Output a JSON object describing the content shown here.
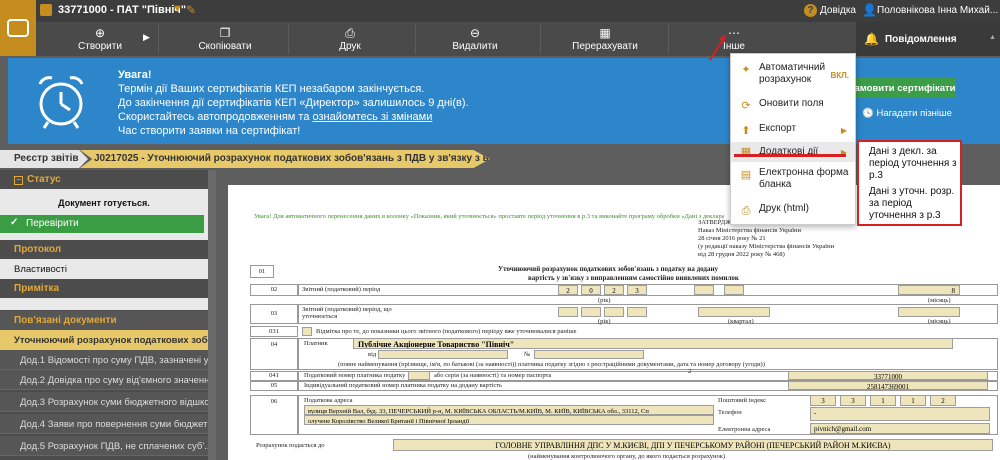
{
  "titlebar": {
    "title": "33771000 - ПАТ \"Північ\"",
    "help": "Довідка",
    "user": "Половнікова Інна Михай..."
  },
  "toolbar": {
    "create": "Створити",
    "copy": "Скопіювати",
    "print": "Друк",
    "delete": "Видалити",
    "recalc": "Перерахувати",
    "more": "Інше",
    "notifications": "Повідомлення"
  },
  "banner": {
    "title": "Увага!",
    "line1": "Термін дії Ваших сертифікатів КЕП незабаром закінчується.",
    "line2": "До закінчення дії сертифікатів КЕП «Директор» залишилось 9 дні(в).",
    "line3_pre": "Скористайтесь автопродовженням та ",
    "line3_link": "ознайомтесь зі змінами",
    "line4": "Час створити заявки на сертифікат!",
    "renew": "Замовити сертифікати",
    "remind": "Нагадати пізніше"
  },
  "breadcrumb": {
    "root": "Реєстр звітів",
    "doc": "J0217025 - Уточнюючий розрахунок податкових зобов'язань з ПДВ у зв'язку з виправ..."
  },
  "left": {
    "status_head": "Статус",
    "status": "Документ готується.",
    "check": "Перевірити",
    "protocol": "Протокол",
    "props": "Властивості",
    "note": "Примітка",
    "related": "Пов'язані документи",
    "items": [
      "Уточнюючий розрахунок податкових зобов'яза...",
      "Дод.1 Відомості про суму ПДВ, зазначені у ПН...",
      "Дод.2 Довідка про суму від'ємного значення з...",
      "Дод.3 Розрахунок суми бюджетного відшкоду...",
      "Дод.4 Заяви про повернення суми бюджетног...",
      "Дод.5 Розрахунок ПДВ, не сплачених суб'..."
    ]
  },
  "menu": {
    "auto": "Автоматичний розрахунок",
    "auto_badge": "ВКЛ.",
    "refresh": "Оновити поля",
    "export": "Експорт",
    "extra": "Додаткові дії",
    "eform": "Електронна форма бланка",
    "print_html": "Друк (html)"
  },
  "submenu": {
    "item1": "Дані з декл. за період уточнення з р.3",
    "item2": "Дані з уточн. розр. за період уточнення з р.3"
  },
  "doc": {
    "notice": "Увага! Для автоматичного перенесення даних в колонку «Показник, який уточнюється» проставте період уточнення в р.3 та виконайте програму обробки «Дані з декларації за період уточнення з р.3»",
    "approved1": "ЗАТВЕРДЖЕНО",
    "approved2": "Наказ Міністерства фінансів України",
    "approved3": "28 січня 2016 року № 21",
    "approved4": "(у редакції наказу Міністерства фінансів України",
    "approved5": "від 28 грудня 2022 року № 468)",
    "title1": "Уточнюючий розрахунок податкових зобов'язань з податку на додану",
    "title2": "вартість у зв'язку з виправленням самостійно виявлених помилок",
    "r01": "01",
    "r02": "02",
    "r02_label": "Звітний (податковий) період",
    "year": [
      "2",
      "0",
      "2",
      "3"
    ],
    "month": "8",
    "year_l": "(рік)",
    "month_l": "(місяць)",
    "r03": "03",
    "r03_label": "Звітний (податковий) період, що уточнюється",
    "quarter_l": "(квартал)",
    "r031": "031",
    "r031_label": "Відмітка про те, до показники цього звітного (податкового) періоду вже уточнювалися раніше",
    "r04": "04",
    "payer": "Платник",
    "payer_name": "Публічне Акціонерне Товариство \"Північ\"",
    "payer_from": "від",
    "payer_no": "№",
    "payer_note": "(повне найменування (прізвище, ім'я, по батькові (за наявності)) платника податку згідно з реєстраційними документами, дата та номер договору (угоди))",
    "r041": "041",
    "r041_label": "Податковий номер платника податку",
    "or_series": "або серія (за наявності) та номер паспорта",
    "tax_no": "33771000",
    "r05": "05",
    "r05_label": "Індивідуальний податковий номер платника податку на додану вартість",
    "ipn": "258147369001",
    "r06": "06",
    "address_label": "Податкова адреса",
    "address": "вулиця Верхній Вал, буд. 33, ПЕЧЕРСЬКИЙ р-н, М. КИЇВСЬКА ОБЛАСТЬ/М.КИЇВ, М. КИЇВ, КИЇВСЬКА обл., 33112, Сп",
    "address2": "олучене Королівство Великої Британії і Північної Ірландії",
    "postal_label": "Поштовий індекс",
    "postal": [
      "3",
      "3",
      "1",
      "1",
      "2"
    ],
    "phone_label": "Телефон",
    "phone": "-",
    "email_label": "Електронна адреса",
    "email": "pivnich@gmail.com",
    "submit_label": "Розрахунок подається до",
    "submit_to": "ГОЛОВНЕ УПРАВЛІННЯ ДПС У М.КИЄВІ, ДПІ У ПЕЧЕРСЬКОМУ РАЙОНІ (ПЕЧЕРСЬКИЙ РАЙОН М.КИЄВА)",
    "submit_note": "(найменування контролюючого органу, до якого подається розрахунок)",
    "two": "2"
  },
  "colors": {
    "accent": "#c58d1e",
    "banner": "#2d86c9",
    "green": "#3a9c43",
    "red": "#d42121"
  }
}
